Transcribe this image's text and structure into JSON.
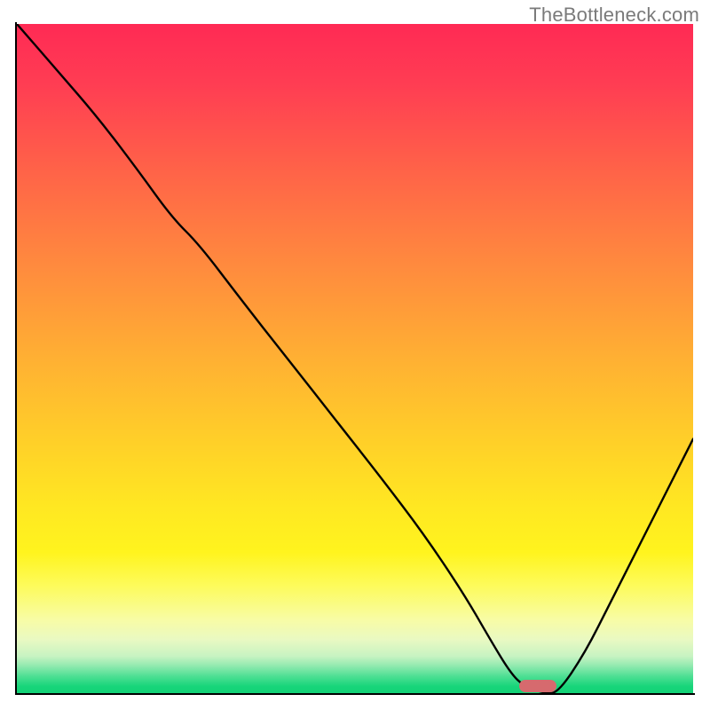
{
  "watermark": "TheBottleneck.com",
  "colors": {
    "curve_stroke": "#000000",
    "axis_stroke": "#000000",
    "marker_fill": "#d66a6e",
    "gradient_top": "#ff2a54",
    "gradient_bottom": "#12d276"
  },
  "chart_data": {
    "type": "line",
    "title": "",
    "xlabel": "",
    "ylabel": "",
    "xlim": [
      0,
      100
    ],
    "ylim": [
      0,
      100
    ],
    "grid": false,
    "series": [
      {
        "name": "bottleneck-curve",
        "x": [
          0,
          6,
          12,
          18,
          23,
          27,
          33,
          40,
          47,
          54,
          60,
          66,
          70,
          73,
          75,
          78,
          80,
          84,
          88,
          92,
          96,
          100
        ],
        "y": [
          100,
          93,
          86,
          78,
          71,
          67,
          59,
          50,
          41,
          32,
          24,
          15,
          8,
          3,
          1,
          0,
          0,
          6,
          14,
          22,
          30,
          38
        ]
      }
    ],
    "annotations": [
      {
        "name": "optimal-marker",
        "shape": "capsule",
        "x": 77,
        "y": 1
      }
    ]
  }
}
